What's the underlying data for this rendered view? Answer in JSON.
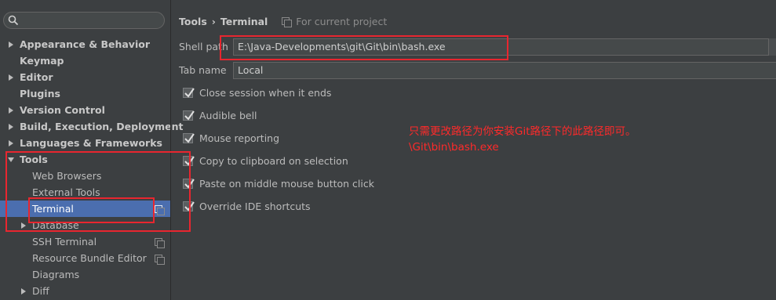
{
  "sidebar": {
    "search_placeholder": "",
    "items": [
      {
        "label": "Appearance & Behavior"
      },
      {
        "label": "Keymap"
      },
      {
        "label": "Editor"
      },
      {
        "label": "Plugins"
      },
      {
        "label": "Version Control"
      },
      {
        "label": "Build, Execution, Deployment"
      },
      {
        "label": "Languages & Frameworks"
      },
      {
        "label": "Tools"
      },
      {
        "label": "Web Browsers"
      },
      {
        "label": "External Tools"
      },
      {
        "label": "Terminal"
      },
      {
        "label": "Database"
      },
      {
        "label": "SSH Terminal"
      },
      {
        "label": "Resource Bundle Editor"
      },
      {
        "label": "Diagrams"
      },
      {
        "label": "Diff"
      }
    ]
  },
  "header": {
    "breadcrumb_parent": "Tools",
    "breadcrumb_separator": "›",
    "breadcrumb_current": "Terminal",
    "scope_label": "For current project"
  },
  "form": {
    "shell_path_label": "Shell path",
    "shell_path_value": "E:\\Java-Developments\\git\\Git\\bin\\bash.exe",
    "tab_name_label": "Tab name",
    "tab_name_value": "Local",
    "checkboxes": [
      {
        "label": "Close session when it ends",
        "checked": true
      },
      {
        "label": "Audible bell",
        "checked": true
      },
      {
        "label": "Mouse reporting",
        "checked": true
      },
      {
        "label": "Copy to clipboard on selection",
        "checked": true
      },
      {
        "label": "Paste on middle mouse button click",
        "checked": true
      },
      {
        "label": "Override IDE shortcuts",
        "checked": true
      }
    ]
  },
  "annotation": {
    "line1": "只需更改路径为你安装Git路径下的此路径即可。",
    "line2": "\\Git\\bin\\bash.exe",
    "color": "#ff2a2a"
  },
  "colors": {
    "background": "#3c3f41",
    "selection": "#4b6eaf",
    "highlight_box": "#e8262f"
  }
}
